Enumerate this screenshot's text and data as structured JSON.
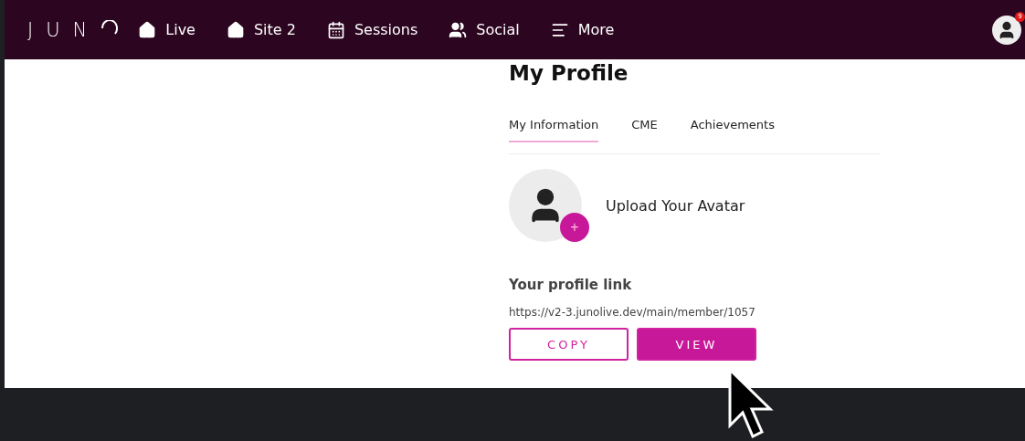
{
  "logo": "JUN",
  "nav": [
    {
      "label": "Live"
    },
    {
      "label": "Site 2"
    },
    {
      "label": "Sessions"
    },
    {
      "label": "Social"
    },
    {
      "label": "More"
    }
  ],
  "account": {
    "badge": "9"
  },
  "title": "My Profile",
  "tabs": [
    {
      "label": "My Information",
      "selected": true
    },
    {
      "label": "CME",
      "selected": false
    },
    {
      "label": "Achievements",
      "selected": false
    }
  ],
  "avatar": {
    "label": "Upload Your Avatar",
    "add": "+"
  },
  "profile_link": {
    "heading": "Your profile link",
    "url": "https://v2-3.junolive.dev/main/member/1057"
  },
  "buttons": [
    {
      "label": "COPY",
      "kind": "outline"
    },
    {
      "label": "VIEW",
      "kind": "filled"
    }
  ]
}
